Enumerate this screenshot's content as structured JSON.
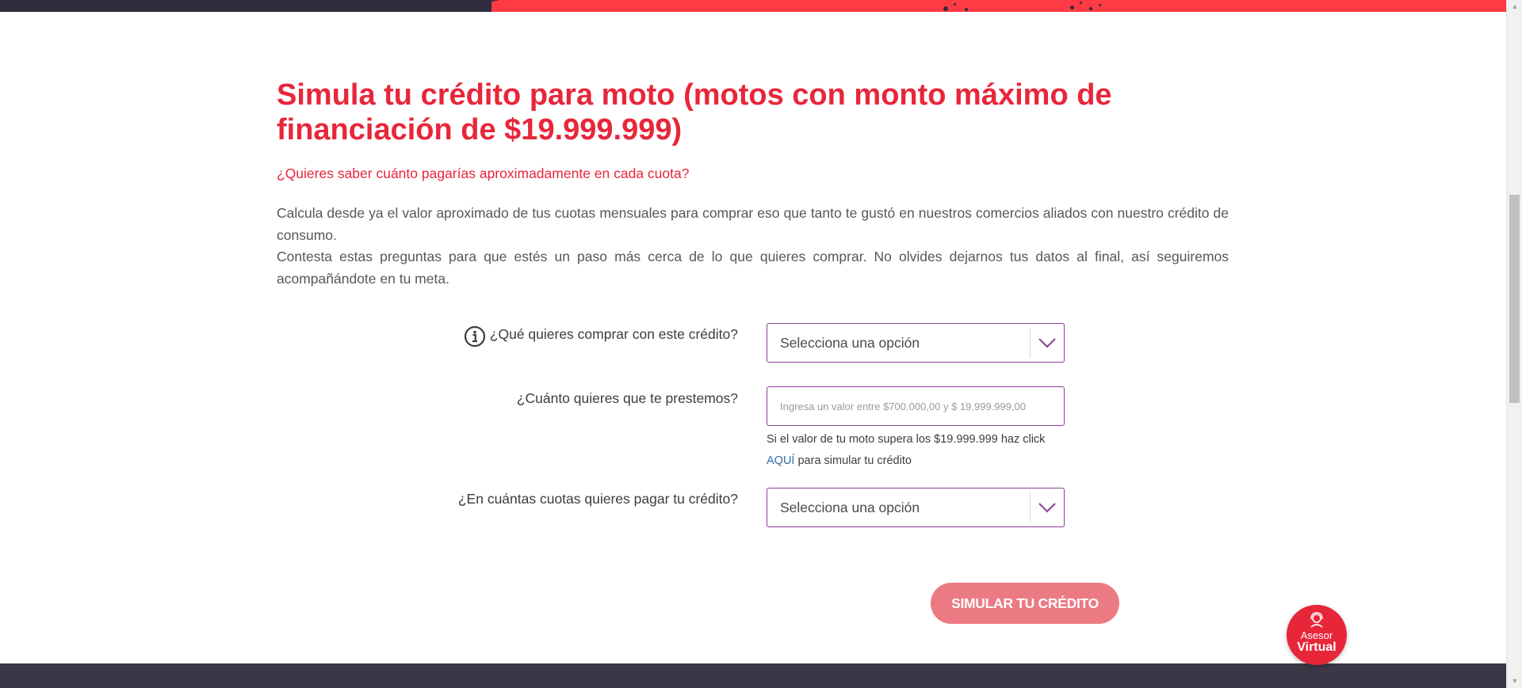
{
  "page": {
    "title": "Simula tu crédito para moto (motos con monto máximo de financiación de $19.999.999)",
    "subtitle": "¿Quieres saber cuánto pagarías aproximadamente en cada cuota?",
    "description": [
      "Calcula desde ya el valor aproximado de tus cuotas mensuales para comprar eso que tanto te gustó en nuestros comercios aliados con nuestro crédito de consumo.",
      "Contesta estas preguntas para que estés un paso más cerca de lo que quieres comprar. No olvides dejarnos tus datos al final, así seguiremos acompañándote en tu meta."
    ]
  },
  "form": {
    "purchase": {
      "label": "¿Qué quieres comprar con este crédito?",
      "selected": "Selecciona una opción",
      "icon": "info-icon"
    },
    "amount": {
      "label": "¿Cuánto quieres que te prestemos?",
      "placeholder": "Ingresa un valor entre $700.000,00 y $ 19.999.999,00",
      "value": "",
      "helper_prefix": "Si el valor de tu moto supera los $19.999.999 haz click",
      "helper_link": "AQUÍ",
      "helper_suffix": "para simular tu crédito"
    },
    "installments": {
      "label": "¿En cuántas cuotas quieres pagar tu crédito?",
      "selected": "Selecciona una opción"
    },
    "submit_label": "SIMULAR TU CRÉDITO"
  },
  "advisor": {
    "line1": "Asesor",
    "line2": "Virtual",
    "icon": "agent-headset-icon"
  },
  "colors": {
    "brand_red": "#e8263a",
    "field_border": "#8a3d96",
    "button_bg": "#ec7a83",
    "link": "#2f6fa8",
    "dark_band": "#3a3846"
  }
}
